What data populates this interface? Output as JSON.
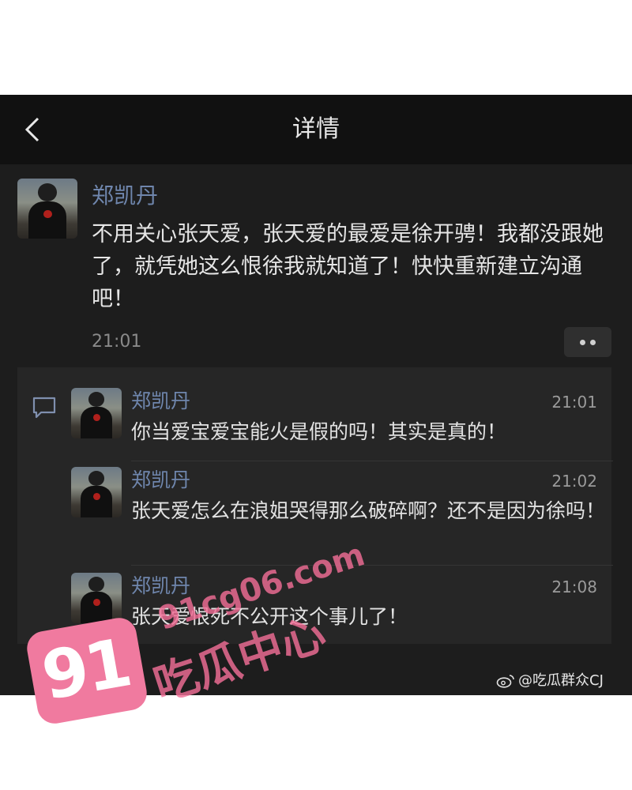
{
  "nav": {
    "title": "详情"
  },
  "post": {
    "author": "郑凯丹",
    "text": "不用关心张天爱，张天爱的最爱是徐开骋！我都没跟她了，就凭她这么恨徐我就知道了！快快重新建立沟通吧！",
    "time": "21:01"
  },
  "replies": [
    {
      "author": "郑凯丹",
      "time": "21:01",
      "text": "你当爱宝爱宝能火是假的吗！其实是真的！"
    },
    {
      "author": "郑凯丹",
      "time": "21:02",
      "text": "张天爱怎么在浪姐哭得那么破碎啊？还不是因为徐吗！"
    },
    {
      "author": "郑凯丹",
      "time": "21:08",
      "text": "张天爱恨死不公开这个事儿了！"
    }
  ],
  "weibo_credit": "@吃瓜群众CJ",
  "watermark": {
    "badge": "91",
    "site": "91cg06.com",
    "brand": "吃瓜中心"
  },
  "icons": {
    "back": "chevron-left-icon",
    "more": "more-dots-icon",
    "comment": "comment-bubble-icon",
    "weibo": "weibo-icon"
  },
  "colors": {
    "name": "#6f86ad",
    "background": "#1d1d1d",
    "navbar": "#111111",
    "watermark": "#f07a9f"
  }
}
